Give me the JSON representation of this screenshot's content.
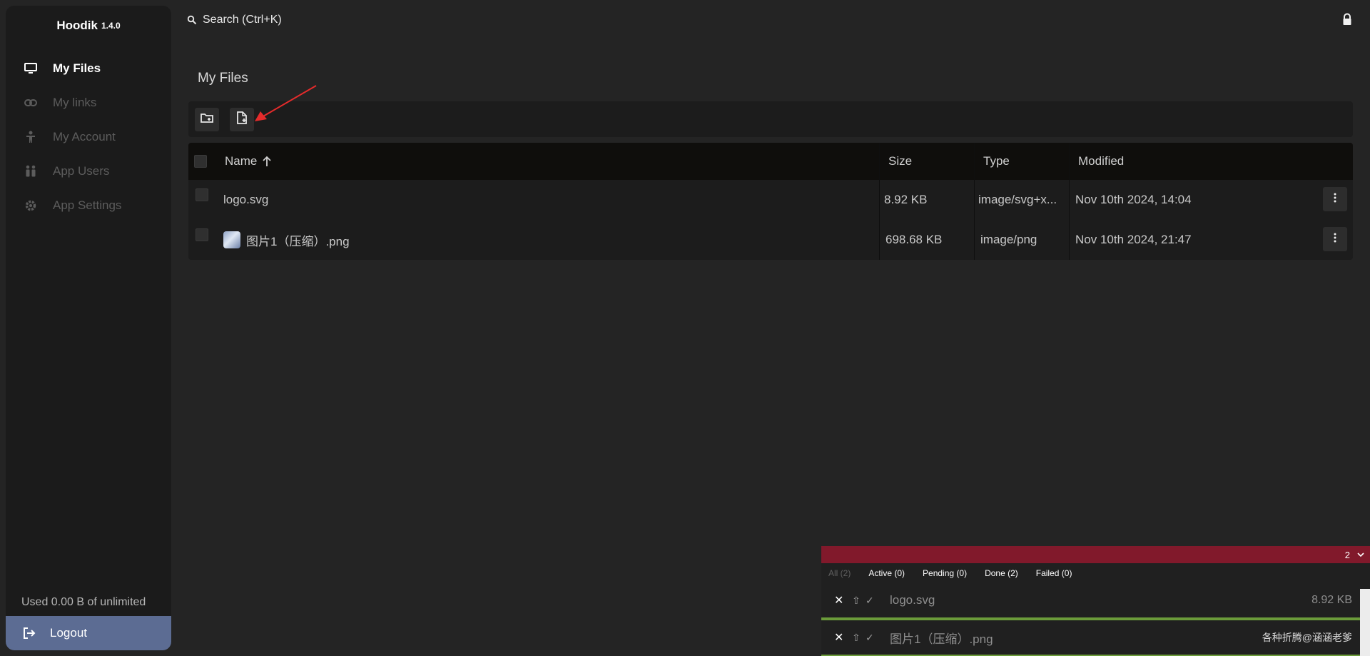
{
  "app": {
    "name": "Hoodik",
    "version": "1.4.0"
  },
  "sidebar": {
    "items": [
      {
        "label": "My Files",
        "icon": "monitor-icon",
        "active": true
      },
      {
        "label": "My links",
        "icon": "link-icon",
        "active": false
      },
      {
        "label": "My Account",
        "icon": "person-icon",
        "active": false
      },
      {
        "label": "App Users",
        "icon": "users-icon",
        "active": false
      },
      {
        "label": "App Settings",
        "icon": "gear-icon",
        "active": false
      }
    ],
    "usage": "Used 0.00 B of unlimited",
    "logout": "Logout"
  },
  "search": {
    "placeholder": "Search (Ctrl+K)"
  },
  "page": {
    "title": "My Files"
  },
  "toolbar": {
    "buttons": [
      "new-folder-icon",
      "new-file-icon"
    ]
  },
  "table": {
    "headers": {
      "name": "Name",
      "size": "Size",
      "type": "Type",
      "modified": "Modified"
    },
    "rows": [
      {
        "name": "logo.svg",
        "size": "8.92 KB",
        "type": "image/svg+x...",
        "modified": "Nov 10th 2024, 14:04"
      },
      {
        "name": "图片1（压缩）.png",
        "size": "698.68 KB",
        "type": "image/png",
        "modified": "Nov 10th 2024, 21:47"
      }
    ]
  },
  "upload_panel": {
    "count": "2",
    "tabs": [
      {
        "label": "All (2)",
        "active": true
      },
      {
        "label": "Active (0)",
        "active": false
      },
      {
        "label": "Pending (0)",
        "active": false
      },
      {
        "label": "Done (2)",
        "active": false
      },
      {
        "label": "Failed (0)",
        "active": false
      }
    ],
    "items": [
      {
        "name": "logo.svg",
        "size": "8.92 KB"
      },
      {
        "name": "图片1（压缩）.png",
        "size": "各种折腾@涵涵老爹"
      }
    ]
  },
  "colors": {
    "sidebar_bg": "#1b1b1b",
    "logout_bg": "#5c6c93",
    "upload_header": "#81192b",
    "progress": "#6b9b3a"
  }
}
